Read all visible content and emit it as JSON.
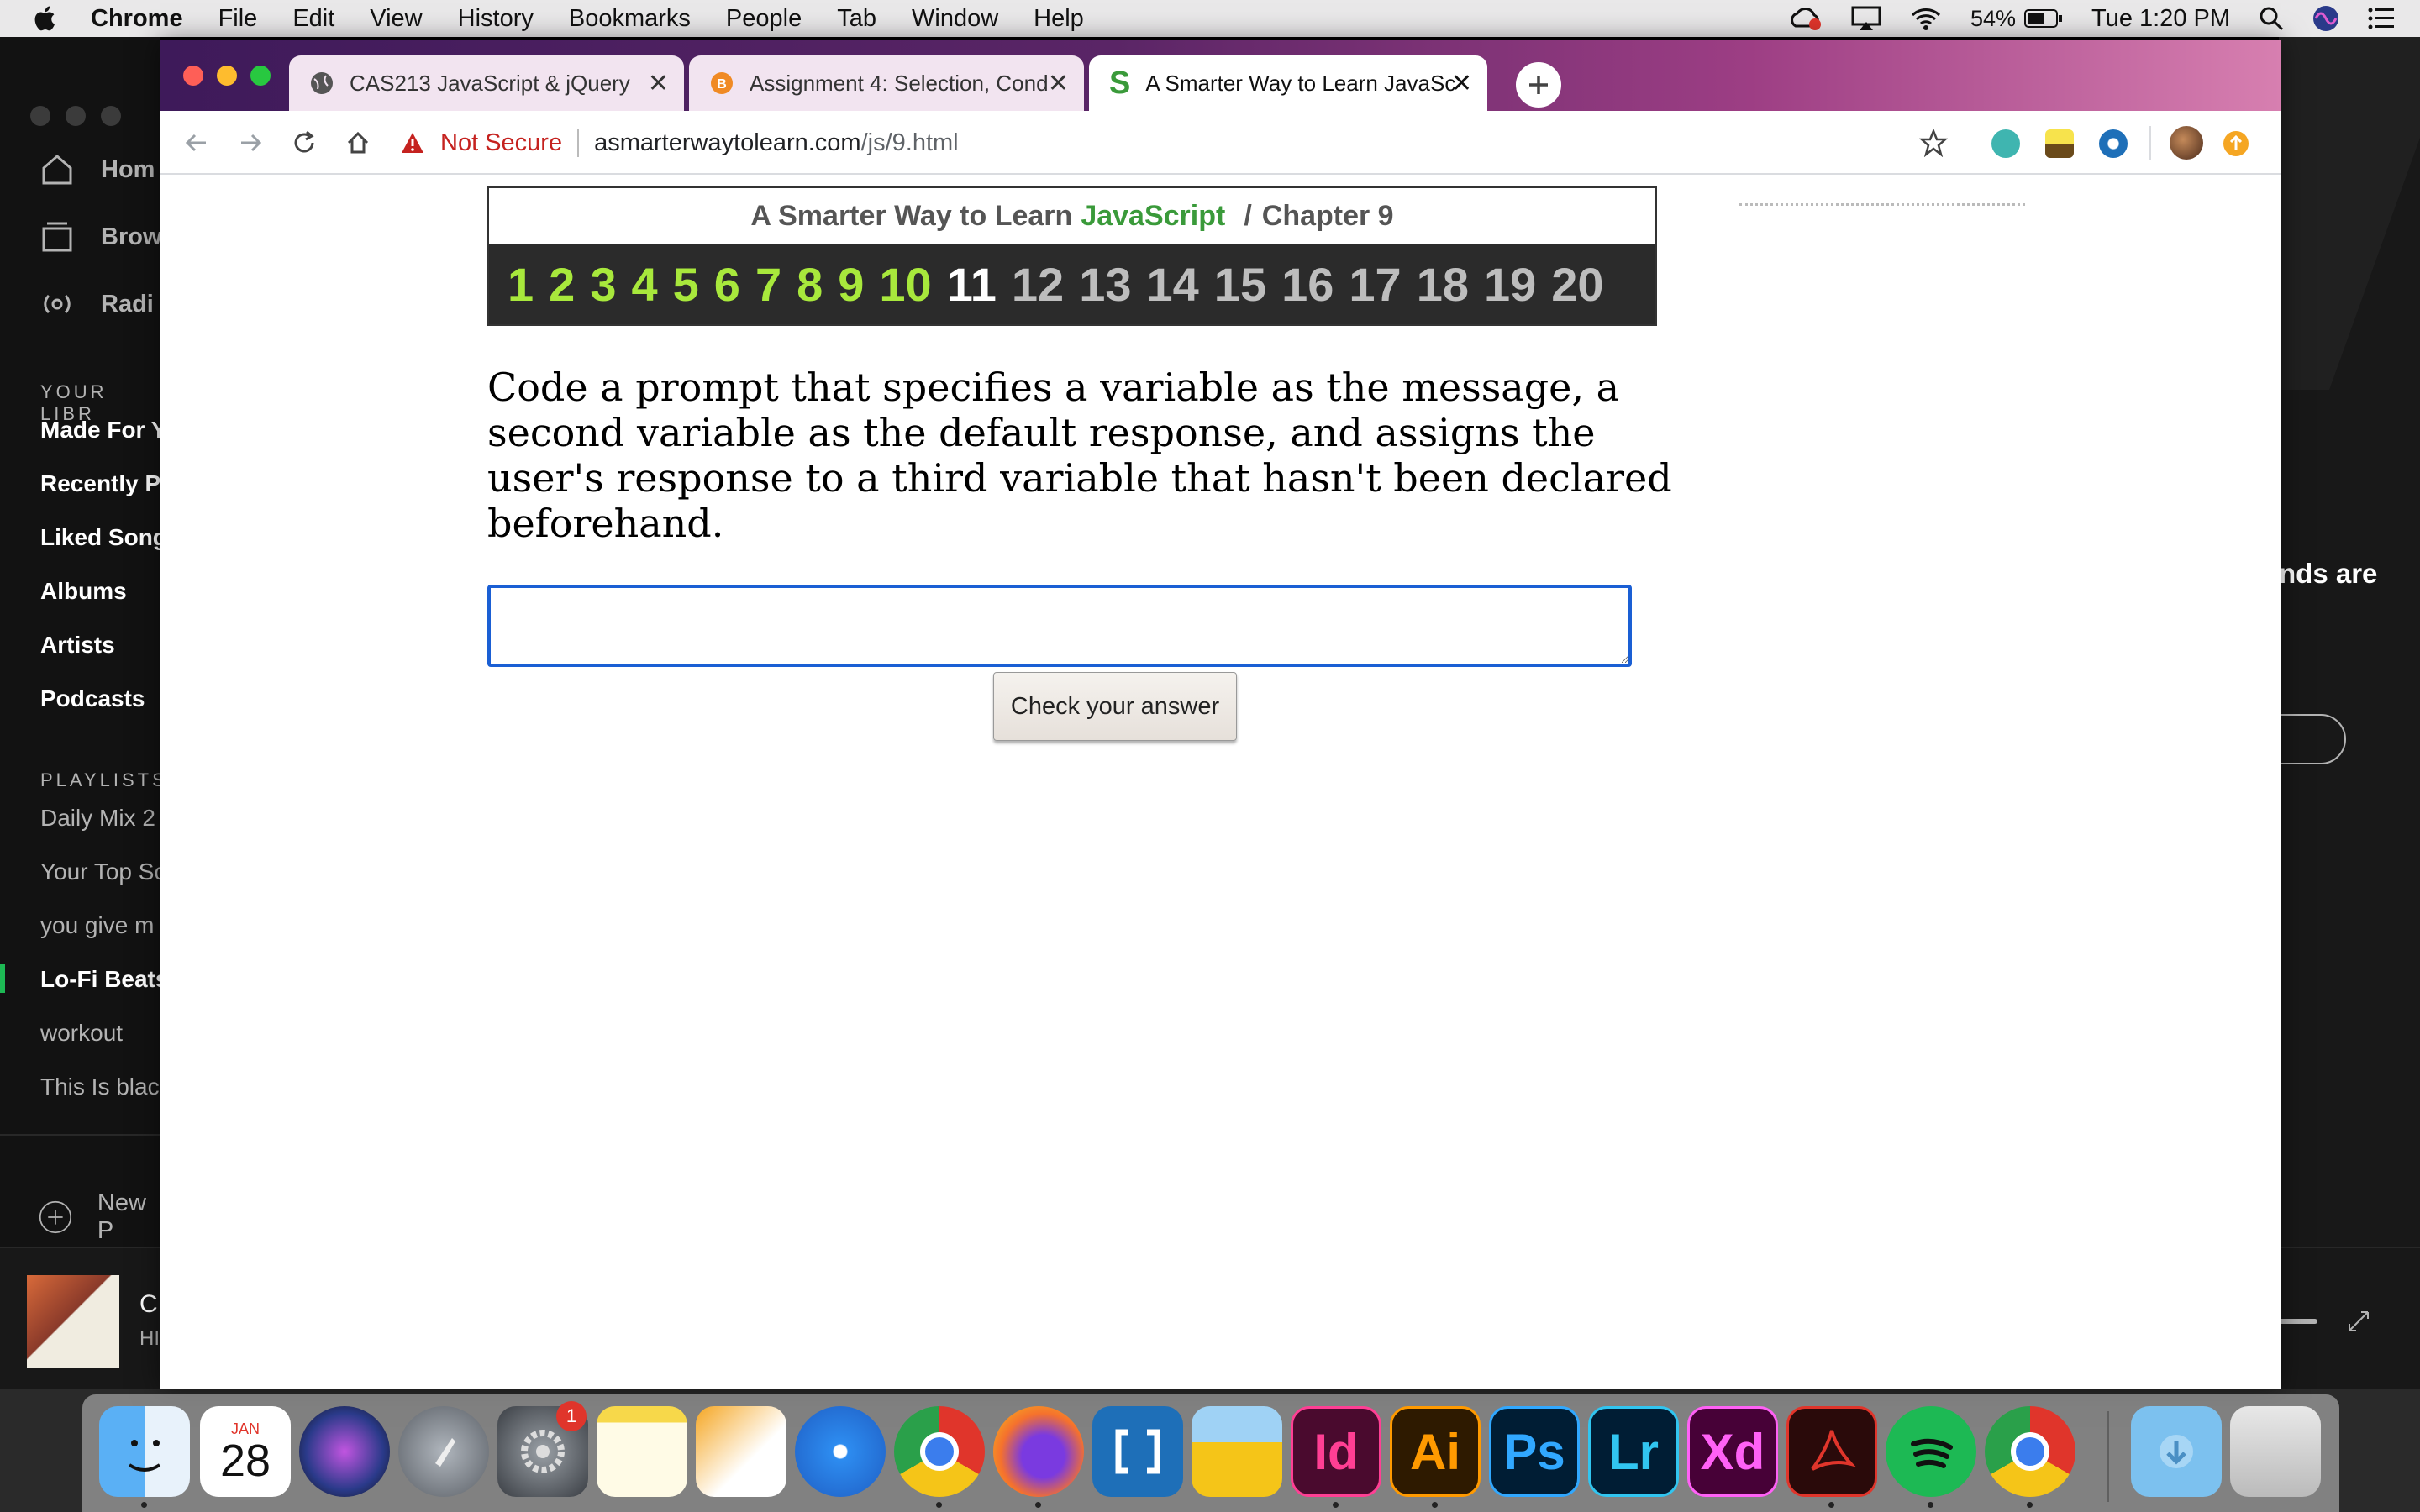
{
  "menubar": {
    "app_name": "Chrome",
    "items": [
      "File",
      "Edit",
      "View",
      "History",
      "Bookmarks",
      "People",
      "Tab",
      "Window",
      "Help"
    ],
    "battery": "54%",
    "clock": "Tue 1:20 PM"
  },
  "spotify": {
    "nav": [
      "Hom",
      "Brow",
      "Radi"
    ],
    "library_heading": "YOUR LIBR",
    "library": [
      "Made For Y",
      "Recently P",
      "Liked Song",
      "Albums",
      "Artists",
      "Podcasts"
    ],
    "playlists_heading": "PLAYLISTS",
    "playlists": [
      "Daily Mix 2",
      "Your Top Sc",
      "you give m",
      "Lo-Fi Beats",
      "workout",
      "This Is blac"
    ],
    "new_playlist": "New P",
    "right_text": "nds are",
    "player_title": "C",
    "player_artist": "HI"
  },
  "chrome": {
    "tabs": [
      {
        "title": "CAS213 JavaScript & jQuery",
        "active": false
      },
      {
        "title": "Assignment 4: Selection, Cond",
        "active": false
      },
      {
        "title": "A Smarter Way to Learn JavaSc",
        "active": true
      }
    ],
    "address": {
      "security_label": "Not Secure",
      "host": "asmarterwaytolearn.com",
      "path": "/js/9.html"
    }
  },
  "page": {
    "banner": {
      "prefix": "A Smarter Way to Learn",
      "brand": "JavaScript",
      "separator": "/",
      "chapter": "Chapter 9"
    },
    "chapters": [
      "1",
      "2",
      "3",
      "4",
      "5",
      "6",
      "7",
      "8",
      "9",
      "10",
      "11",
      "12",
      "13",
      "14",
      "15",
      "16",
      "17",
      "18",
      "19",
      "20"
    ],
    "chapter_colors": {
      "done": "#a8e83c",
      "current": "#ffffff",
      "todo": "#bdbdbd"
    },
    "question": "Code a prompt that specifies a variable as the message, a second variable as the default response, and assigns the user's response to a third variable that hasn't been declared beforehand.",
    "answer_value": "",
    "check_button": "Check your answer"
  },
  "dock": {
    "calendar_month": "JAN",
    "calendar_day": "28",
    "settings_badge": "1",
    "apps": [
      "Finder",
      "Calendar",
      "Siri",
      "Launchpad",
      "System Preferences",
      "Notes",
      "Pages",
      "Safari",
      "Chrome",
      "Firefox",
      "Brackets",
      "Transmit",
      "InDesign",
      "Illustrator",
      "Photoshop",
      "Lightroom",
      "XD",
      "Acrobat",
      "Spotify",
      "Chrome",
      "Downloads",
      "Trash"
    ],
    "labels": {
      "id": "Id",
      "ai": "Ai",
      "ps": "Ps",
      "lr": "Lr",
      "xd": "Xd"
    }
  }
}
